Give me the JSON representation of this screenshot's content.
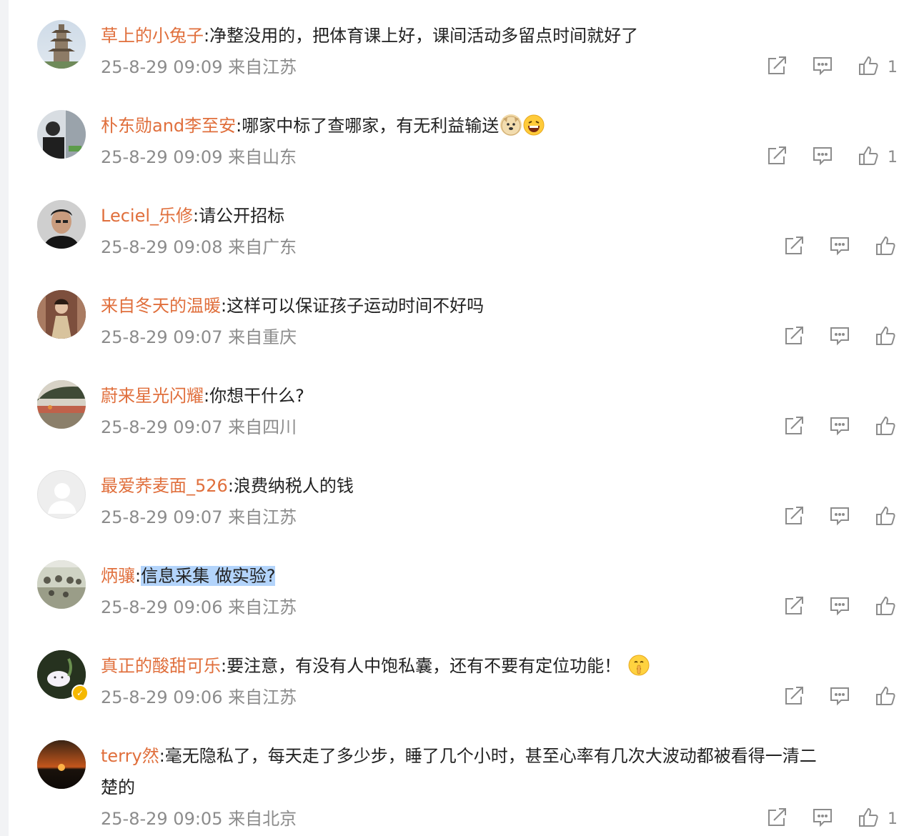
{
  "comments": [
    {
      "user": "草上的小兔子",
      "text": "净整没用的，把体育课上好，课间活动多留点时间就好了",
      "time": "25-8-29 09:09",
      "location": "来自江苏",
      "likes": "1",
      "avatar": "pagoda"
    },
    {
      "user": "朴东勋and李至安",
      "text": "哪家中标了查哪家，有无利益输送",
      "time": "25-8-29 09:09",
      "location": "来自山东",
      "likes": "1",
      "avatar": "person-dark",
      "emojis": [
        "doge-emoji",
        "laugh-emoji"
      ]
    },
    {
      "user": "Leciel_乐修",
      "text": "请公开招标",
      "time": "25-8-29 09:08",
      "location": "来自广东",
      "likes": "",
      "avatar": "portrait-man"
    },
    {
      "user": "来自冬天的温暖",
      "text": "这样可以保证孩子运动时间不好吗",
      "time": "25-8-29 09:07",
      "location": "来自重庆",
      "likes": "",
      "avatar": "portrait-woman"
    },
    {
      "user": "蔚来星光闪耀",
      "text": "你想干什么?",
      "time": "25-8-29 09:07",
      "location": "来自四川",
      "likes": "",
      "avatar": "landscape"
    },
    {
      "user": "最爱荞麦面_526",
      "text": "浪费纳税人的钱",
      "time": "25-8-29 09:07",
      "location": "来自江苏",
      "likes": "",
      "avatar": "default"
    },
    {
      "user": "炳骧",
      "text": "信息采集 做实验?",
      "time": "25-8-29 09:06",
      "location": "来自江苏",
      "likes": "",
      "avatar": "group-photo",
      "highlight": true
    },
    {
      "user": "真正的酸甜可乐",
      "text": "要注意，有没有人中饱私囊，还有不要有定位功能！",
      "time": "25-8-29 09:06",
      "location": "来自江苏",
      "likes": "",
      "avatar": "cartoon",
      "verified": true,
      "emojis": [
        "shush-emoji"
      ]
    },
    {
      "user": "terry然",
      "text": "毫无隐私了，每天走了多少步，睡了几个小时，甚至心率有几次大波动都被看得一清二",
      "text2": "楚的",
      "time": "25-8-29 09:05",
      "location": "来自北京",
      "likes": "1",
      "avatar": "sunset"
    }
  ],
  "colors": {
    "username": "#e06f3c",
    "meta": "#8c8c8c",
    "text": "#222222",
    "highlight": "#b3d4fb",
    "icon": "#8c8c8c"
  },
  "icons": {
    "share": "share-icon",
    "comment": "comment-icon",
    "like": "like-icon"
  }
}
